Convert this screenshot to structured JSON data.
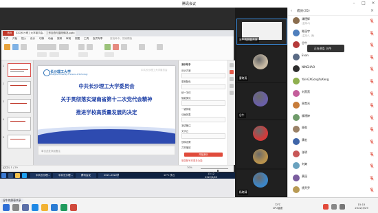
{
  "window": {
    "title": "腾讯会议"
  },
  "wps": {
    "tabs": [
      "首页",
      "中共长沙理工大学委员会…",
      "工作自查与整改情况.pptx"
    ],
    "menu": [
      "文件",
      "开始",
      "插入",
      "设计",
      "切换",
      "动画",
      "放映",
      "审阅",
      "视图",
      "工具",
      "会员专享",
      "查找命令、搜索模板"
    ],
    "slide_count_labels": [
      "1",
      "2",
      "3",
      "4",
      "5"
    ],
    "slide": {
      "school": "长沙理工大学",
      "school_en": "Changsha University of Science & Technology",
      "watermark": "中共长沙理工大学委员会",
      "title_lines": [
        "中共长沙理工大学委员会",
        "关于贯彻落实湖南省第十二次党代会精神",
        "推进学校高质量发展的决定"
      ]
    },
    "notes_placeholder": "单击此处添加备注",
    "side_panel": {
      "header": "演示助手",
      "lines": [
        "设计方案",
        "更换配色",
        "统一字体",
        "智能美化",
        "一键排版",
        "动画效果",
        "演讲备注",
        "文字云",
        "放映设置",
        "共享播放"
      ],
      "button": "开始演示",
      "footer": "登录账号享更多功能"
    },
    "status": {
      "page": "幻灯片 1 / 29",
      "zoom": "70%"
    }
  },
  "inner_taskbar": {
    "tasks": [
      "中共长沙理…",
      "中共长沙理…",
      "腾讯会议",
      "2021-2022学…"
    ],
    "weather": "13°C 多云",
    "time": "13:12",
    "date": "2022/3/28"
  },
  "videos": [
    {
      "name": "谷牛的屏幕共享",
      "avatar_color": "#7aa0c8",
      "share": true
    },
    {
      "name": "曹晓雨",
      "avatar_color": "#c7b9a3"
    },
    {
      "name": "谷牛",
      "avatar_color": "#6a5fa8"
    },
    {
      "name": "曲淑珍",
      "avatar_color": "#d13b3b"
    },
    {
      "name": "",
      "avatar_color": "#b8924d"
    },
    {
      "name": "杨晓晴",
      "avatar_color": "#3c86c8"
    }
  ],
  "members": {
    "title": "成员(35)",
    "speaking_tip": "正在讲话: 谷牛",
    "list": [
      {
        "name": "谭德辉",
        "sub": "(主持人)",
        "color": "#8a6d4e"
      },
      {
        "name": "陈冠宇",
        "sub": "(主持人、我)",
        "color": "#4f7fbd"
      },
      {
        "name": "谷牛",
        "sub": "",
        "color": "#b53a3a"
      },
      {
        "name": "Evan",
        "sub": "",
        "color": "#5a6a84"
      },
      {
        "name": "NINGHAO",
        "sub": "",
        "color": "#2d2d2d"
      },
      {
        "name": "Yail-GXGongYuXeng",
        "sub": "",
        "color": "#8fb04f"
      },
      {
        "name": "刘黑黑",
        "sub": "",
        "color": "#c45e9b"
      },
      {
        "name": "周育光",
        "sub": "",
        "color": "#c77c3a"
      },
      {
        "name": "柳建婷",
        "sub": "",
        "color": "#6f9b6a"
      },
      {
        "name": "顾劲",
        "sub": "",
        "color": "#9a8167"
      },
      {
        "name": "康宏",
        "sub": "",
        "color": "#3f65a8"
      },
      {
        "name": "张明",
        "sub": "",
        "color": "#c85757"
      },
      {
        "name": "刘爽",
        "sub": "",
        "color": "#6aa2bf"
      },
      {
        "name": "黄冠",
        "sub": "",
        "color": "#7b5d9f"
      },
      {
        "name": "杨乔乔",
        "sub": "",
        "color": "#b89a54"
      }
    ]
  },
  "os_taskbar": {
    "share_label": "谷牛的屏幕共享",
    "cpu_temp": "72℃",
    "cpu_label": "CPU温度",
    "time": "15:15",
    "date": "2022/3/29"
  },
  "colors": {
    "wps_red": "#c0392b",
    "slide_title_blue": "#1d3fa6",
    "accent_blue": "#2a6fb6"
  }
}
